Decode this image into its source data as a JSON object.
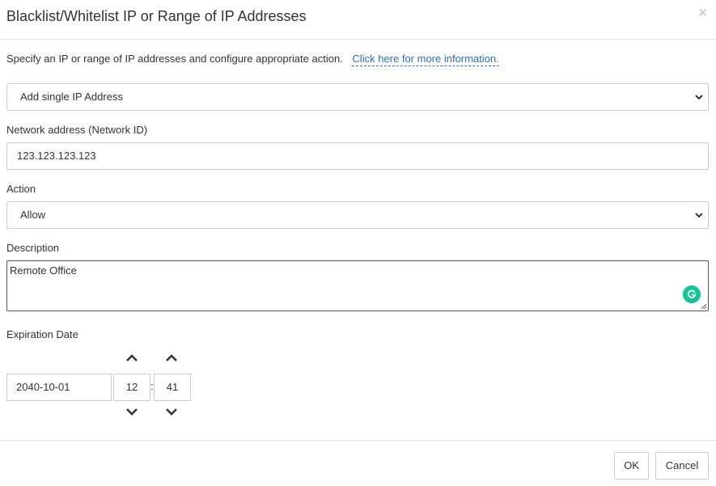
{
  "dialog": {
    "title": "Blacklist/Whitelist IP or Range of IP Addresses",
    "close_icon": "close-icon"
  },
  "intro": {
    "text": "Specify an IP or range of IP addresses and configure appropriate action.",
    "link": "Click here for more information."
  },
  "mode_select": {
    "value": "Add single IP Address"
  },
  "network": {
    "label": "Network address (Network ID)",
    "value": "123.123.123.123"
  },
  "action": {
    "label": "Action",
    "value": "Allow"
  },
  "description": {
    "label": "Description",
    "value": "Remote Office"
  },
  "expiration": {
    "label": "Expiration Date",
    "date": "2040-10-01",
    "hour": "12",
    "separator": ":",
    "minute": "41"
  },
  "footer": {
    "ok_label": "OK",
    "cancel_label": "Cancel"
  },
  "colors": {
    "link": "#2a6ebb",
    "grammarly": "#15c39a",
    "border": "#cccccc"
  }
}
